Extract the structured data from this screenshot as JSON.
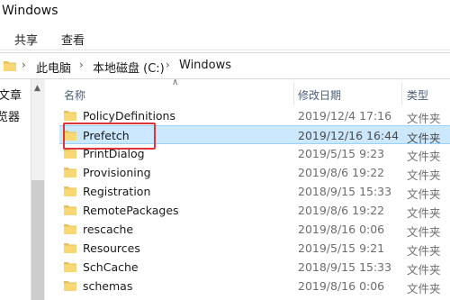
{
  "window": {
    "title": "Windows"
  },
  "ribbon": {
    "tabs": [
      "共享",
      "查看"
    ]
  },
  "address": {
    "crumbs": [
      "此电脑",
      "本地磁盘 (C:)",
      "Windows"
    ]
  },
  "nav": {
    "items": [
      "文章",
      "览器"
    ]
  },
  "columns": {
    "name": "名称",
    "date": "修改日期",
    "type": "类型"
  },
  "files": [
    {
      "name": "PolicyDefinitions",
      "date": "2019/12/4 17:16",
      "type": "文件夹"
    },
    {
      "name": "Prefetch",
      "date": "2019/12/16 16:44",
      "type": "文件夹",
      "selected": true
    },
    {
      "name": "PrintDialog",
      "date": "2019/5/15 9:23",
      "type": "文件夹"
    },
    {
      "name": "Provisioning",
      "date": "2019/8/6 19:22",
      "type": "文件夹"
    },
    {
      "name": "Registration",
      "date": "2018/9/15 15:33",
      "type": "文件夹"
    },
    {
      "name": "RemotePackages",
      "date": "2019/8/6 19:22",
      "type": "文件夹"
    },
    {
      "name": "rescache",
      "date": "2019/8/16 0:06",
      "type": "文件夹"
    },
    {
      "name": "Resources",
      "date": "2019/5/15 9:21",
      "type": "文件夹"
    },
    {
      "name": "SchCache",
      "date": "2018/9/15 15:33",
      "type": "文件夹"
    },
    {
      "name": "schemas",
      "date": "2019/8/16 0:06",
      "type": "文件夹"
    }
  ],
  "colors": {
    "folder": "#e8c158",
    "folder_front": "#f8d775",
    "selection": "#cce8ff",
    "highlight": "#e0343b"
  }
}
